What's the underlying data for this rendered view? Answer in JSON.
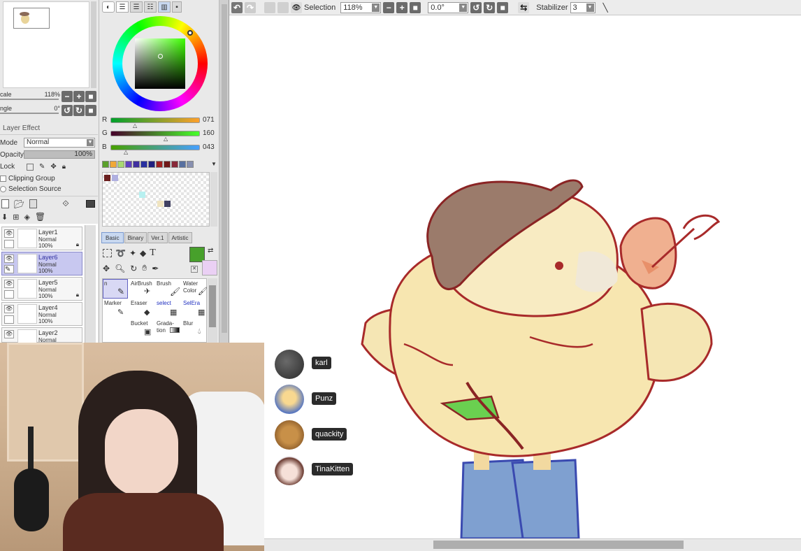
{
  "navigator": {
    "scale_label": "cale",
    "scale_value": "118%",
    "angle_label": "ngle",
    "angle_value": "0°"
  },
  "layer_panel": {
    "title": "Layer Effect",
    "mode_label": "Mode",
    "mode_value": "Normal",
    "opacity_label": "Opacity",
    "opacity_value": "100%",
    "lock_label": "Lock",
    "clipping_label": "Clipping Group",
    "selection_source_label": "Selection Source",
    "layers": [
      {
        "name": "Layer1",
        "mode": "Normal",
        "opacity": "100%"
      },
      {
        "name": "Layer6",
        "mode": "Normal",
        "opacity": "100%"
      },
      {
        "name": "Layer5",
        "mode": "Normal",
        "opacity": "100%"
      },
      {
        "name": "Layer4",
        "mode": "Normal",
        "opacity": "100%"
      },
      {
        "name": "Layer2",
        "mode": "Normal",
        "opacity": ""
      }
    ]
  },
  "color": {
    "r_label": "R",
    "r_value": "071",
    "g_label": "G",
    "g_value": "160",
    "b_label": "B",
    "b_value": "043",
    "current": "#47a02b",
    "secondary": "#e8c8f0",
    "palette": [
      "#5aa02b",
      "#f0a838",
      "#a8d870",
      "#6040c0",
      "#4030a0",
      "#2830a0",
      "#202080",
      "#a02020",
      "#701818",
      "#882838",
      "#5870a0",
      "#8890b0"
    ]
  },
  "tool_tabs": [
    "Basic",
    "Binary",
    "Ver.1",
    "Artistic"
  ],
  "tools": [
    {
      "name": "n",
      "top": "",
      "bot": ""
    },
    {
      "name": "AirBrush",
      "top": "",
      "bot": ""
    },
    {
      "name": "Brush",
      "top": "",
      "bot": ""
    },
    {
      "name": "Water",
      "top": "Color",
      "bot": ""
    },
    {
      "name": "Marker",
      "top": "",
      "bot": ""
    },
    {
      "name": "Eraser",
      "top": "",
      "bot": ""
    },
    {
      "name": "select",
      "top": "",
      "bot": ""
    },
    {
      "name": "SelEra",
      "top": "",
      "bot": ""
    },
    {
      "name": "Bucket",
      "top": "",
      "bot": ""
    },
    {
      "name": "Grada-",
      "top": "tion",
      "bot": ""
    },
    {
      "name": "Blur",
      "top": "",
      "bot": ""
    }
  ],
  "toolbar": {
    "selection_label": "Selection",
    "zoom_value": "118%",
    "rotation_value": "0.0°",
    "stabilizer_label": "Stabilizer",
    "stabilizer_value": "3"
  },
  "call_participants": [
    {
      "name": "karl"
    },
    {
      "name": "Punz"
    },
    {
      "name": "quackity"
    },
    {
      "name": "TinaKitten"
    }
  ]
}
